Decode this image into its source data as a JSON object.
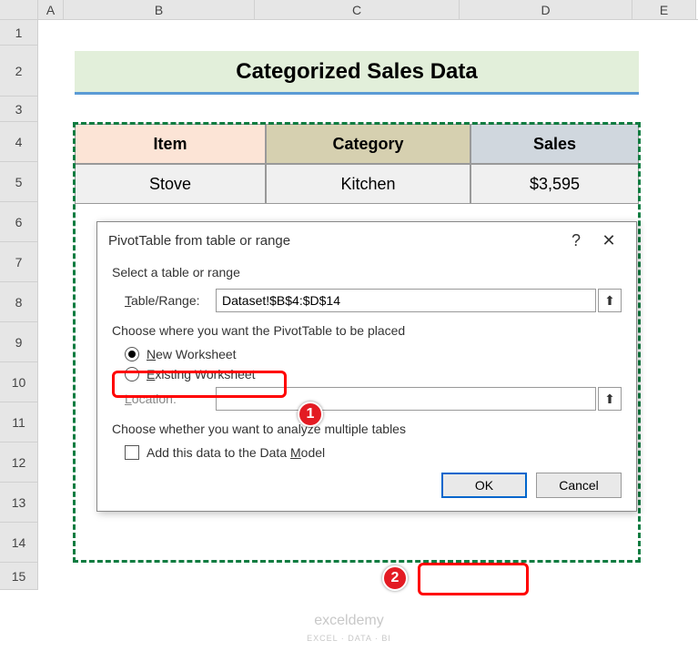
{
  "columns": {
    "A": "A",
    "B": "B",
    "C": "C",
    "D": "D",
    "E": "E"
  },
  "rows": [
    "1",
    "2",
    "3",
    "4",
    "5",
    "6",
    "7",
    "8",
    "9",
    "10",
    "11",
    "12",
    "13",
    "14",
    "15"
  ],
  "title": "Categorized Sales Data",
  "table": {
    "headers": {
      "item": "Item",
      "category": "Category",
      "sales": "Sales"
    },
    "row1": {
      "item": "Stove",
      "category": "Kitchen",
      "sales": "$3,595"
    }
  },
  "dialog": {
    "title": "PivotTable from table or range",
    "help": "?",
    "close": "✕",
    "section1": "Select a table or range",
    "table_range_label": "Table/Range:",
    "table_range_value": "Dataset!$B$4:$D$14",
    "section2": "Choose where you want the PivotTable to be placed",
    "radio_new": "New Worksheet",
    "radio_existing": "Existing Worksheet",
    "location_label": "Location:",
    "location_value": "",
    "section3": "Choose whether you want to analyze multiple tables",
    "checkbox_label": "Add this data to the Data Model",
    "ok": "OK",
    "cancel": "Cancel",
    "picker": "⬆"
  },
  "badges": {
    "b1": "1",
    "b2": "2"
  },
  "watermark": {
    "main": "exceldemy",
    "sub": "EXCEL · DATA · BI"
  }
}
